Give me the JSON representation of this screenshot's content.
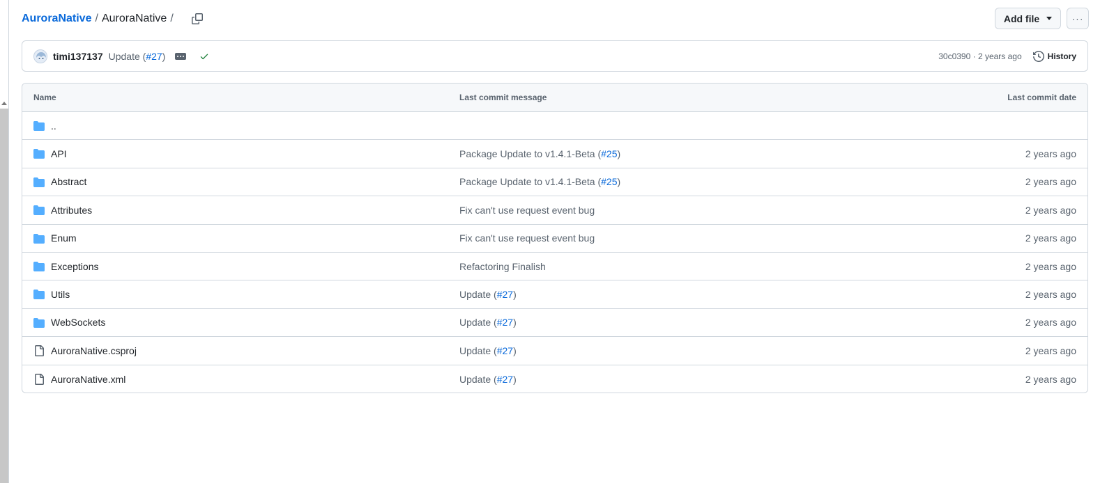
{
  "breadcrumb": {
    "repo": "AuroraNative",
    "sep1": "/",
    "folder": "AuroraNative",
    "sep2": "/"
  },
  "actions": {
    "add_file": "Add file",
    "more": "···"
  },
  "commit": {
    "author": "timi137137",
    "message_prefix": "Update (",
    "pr": "#27",
    "message_suffix": ")",
    "sha": "30c0390",
    "dot": " · ",
    "age": "2 years ago",
    "history": "History"
  },
  "table": {
    "headers": {
      "name": "Name",
      "message": "Last commit message",
      "date": "Last commit date"
    },
    "parent": "..",
    "rows": [
      {
        "type": "folder",
        "name": "API",
        "msg_prefix": "Package Update to v1.4.1-Beta (",
        "pr": "#25",
        "msg_suffix": ")",
        "date": "2 years ago"
      },
      {
        "type": "folder",
        "name": "Abstract",
        "msg_prefix": "Package Update to v1.4.1-Beta (",
        "pr": "#25",
        "msg_suffix": ")",
        "date": "2 years ago"
      },
      {
        "type": "folder",
        "name": "Attributes",
        "msg_prefix": "Fix can't use request event bug",
        "pr": "",
        "msg_suffix": "",
        "date": "2 years ago"
      },
      {
        "type": "folder",
        "name": "Enum",
        "msg_prefix": "Fix can't use request event bug",
        "pr": "",
        "msg_suffix": "",
        "date": "2 years ago"
      },
      {
        "type": "folder",
        "name": "Exceptions",
        "msg_prefix": "Refactoring Finalish",
        "pr": "",
        "msg_suffix": "",
        "date": "2 years ago"
      },
      {
        "type": "folder",
        "name": "Utils",
        "msg_prefix": "Update (",
        "pr": "#27",
        "msg_suffix": ")",
        "date": "2 years ago"
      },
      {
        "type": "folder",
        "name": "WebSockets",
        "msg_prefix": "Update (",
        "pr": "#27",
        "msg_suffix": ")",
        "date": "2 years ago"
      },
      {
        "type": "file",
        "name": "AuroraNative.csproj",
        "msg_prefix": "Update (",
        "pr": "#27",
        "msg_suffix": ")",
        "date": "2 years ago"
      },
      {
        "type": "file",
        "name": "AuroraNative.xml",
        "msg_prefix": "Update (",
        "pr": "#27",
        "msg_suffix": ")",
        "date": "2 years ago"
      }
    ]
  },
  "colors": {
    "link": "#0969da",
    "folder": "#54aeff",
    "muted": "#59636e",
    "border": "#d0d7de",
    "success": "#1a7f37"
  },
  "icons": {
    "folder": "folder-icon",
    "file": "file-icon",
    "copy": "copy-icon",
    "history": "history-icon",
    "check": "check-icon"
  }
}
